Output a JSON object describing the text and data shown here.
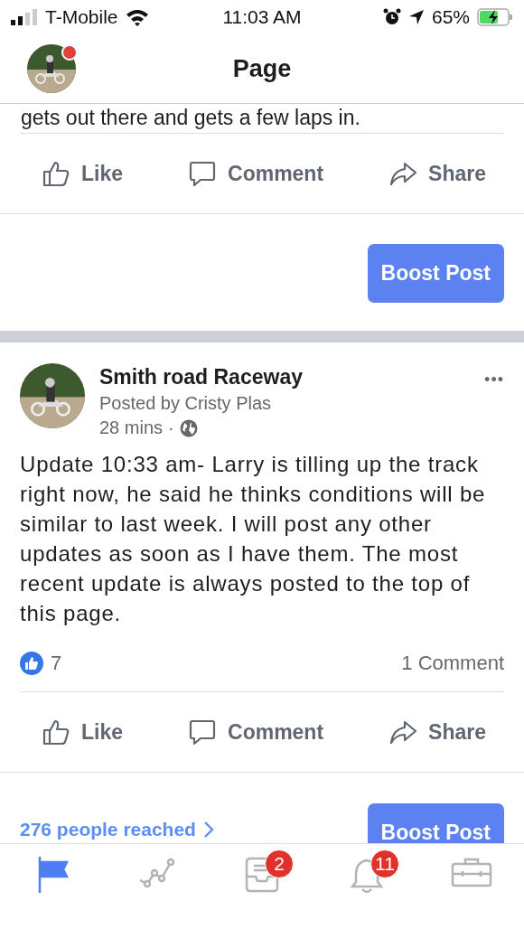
{
  "status_bar": {
    "carrier": "T-Mobile",
    "time": "11:03 AM",
    "battery": "65%"
  },
  "header": {
    "title": "Page",
    "has_notification": true
  },
  "previous_post": {
    "text_tail": "gets out there and gets a few laps in.",
    "actions": [
      "Like",
      "Comment",
      "Share"
    ],
    "boost": "Boost Post"
  },
  "post": {
    "page_name": "Smith road Raceway",
    "posted_by": "Posted by Cristy Plas",
    "time": "28 mins",
    "separator": "·",
    "menu": "•••",
    "body": "Update 10:33 am- Larry is tilling up the track right now, he said he thinks conditions will be similar to last week. I will post any other updates as soon as I have them. The most recent update is always posted to the top of this page.",
    "likes": "7",
    "comments": "1 Comment",
    "actions": [
      "Like",
      "Comment",
      "Share"
    ],
    "reach": "276 people reached",
    "boost": "Boost Post"
  },
  "tabs": [
    {
      "kind": "flag",
      "selected": true
    },
    {
      "kind": "chart",
      "selected": false
    },
    {
      "kind": "inbox",
      "selected": false,
      "badge": "2"
    },
    {
      "kind": "bell",
      "selected": false,
      "badge": "11"
    },
    {
      "kind": "briefcase",
      "selected": false
    }
  ]
}
